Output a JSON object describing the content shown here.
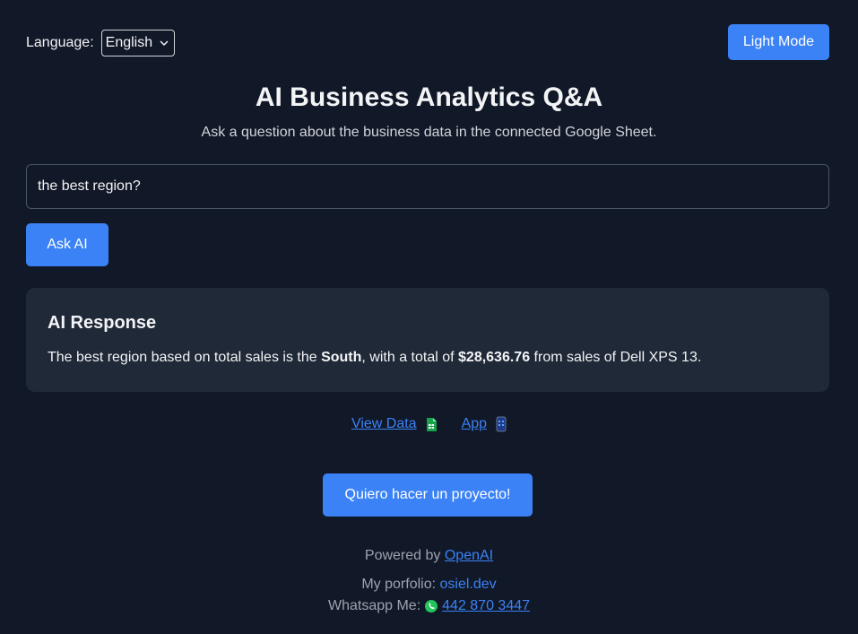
{
  "header": {
    "language_label": "Language:",
    "language_value": "English",
    "mode_button": "Light Mode"
  },
  "hero": {
    "title": "AI Business Analytics Q&A",
    "subtitle": "Ask a question about the business data in the connected Google Sheet."
  },
  "query": {
    "value": "the best region?",
    "ask_button": "Ask AI"
  },
  "response": {
    "title": "AI Response",
    "text_before_region": "The best region based on total sales is the ",
    "region": "South",
    "text_before_total": ", with a total of ",
    "total": "$28,636.76",
    "text_after_total": " from sales of Dell XPS 13."
  },
  "links": {
    "view_data": "View Data",
    "view_data_icon": "google-sheets-icon",
    "app": "App",
    "app_icon": "mobile-phone-icon"
  },
  "cta": {
    "label": "Quiero hacer un proyecto!"
  },
  "footer": {
    "powered_prefix": "Powered by",
    "powered_link": "OpenAI",
    "portfolio_prefix": "My porfolio:",
    "portfolio_link": "osiel.dev",
    "whatsapp_prefix": "Whatsapp Me:",
    "whatsapp_icon": "whatsapp-icon",
    "phone": "442 870 3447"
  },
  "colors": {
    "background": "#111827",
    "panel": "#1f2937",
    "accent": "#3b82f6"
  }
}
